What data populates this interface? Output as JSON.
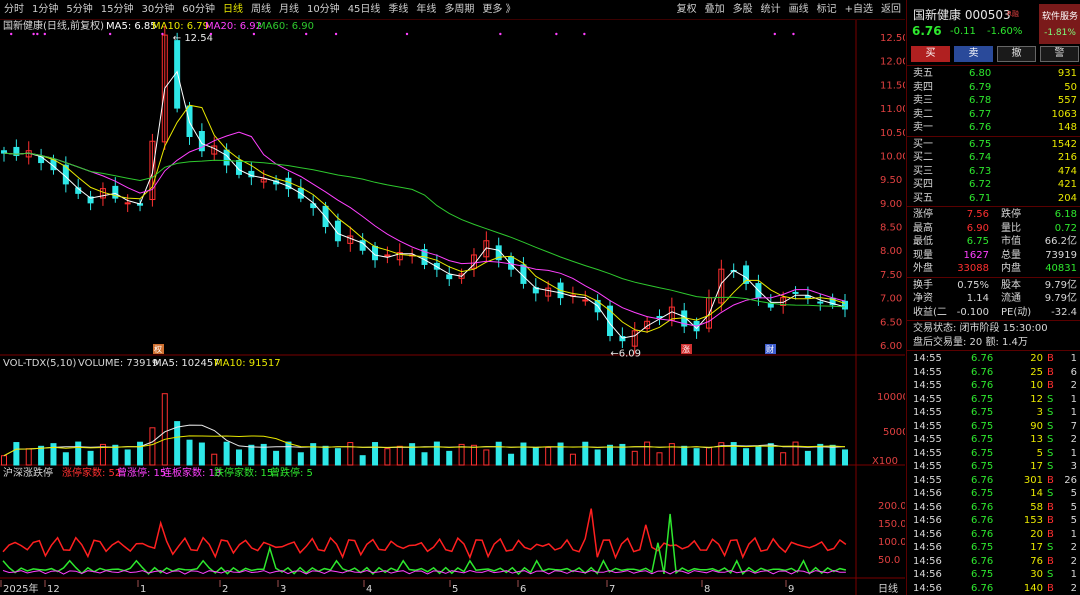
{
  "toolbar": {
    "periods": [
      "分时",
      "1分钟",
      "5分钟",
      "15分钟",
      "30分钟",
      "60分钟",
      "日线",
      "周线",
      "月线",
      "10分钟",
      "45日线",
      "季线",
      "年线",
      "多周期",
      "更多 》"
    ],
    "active_period": "日线",
    "right_items": [
      "复权",
      "叠加",
      "多股",
      "统计",
      "画线",
      "标记",
      "+自选",
      "返回"
    ]
  },
  "main_legend": {
    "title": "国新健康(日线,前复权)",
    "ma5": "MA5: 6.85",
    "ma10": "MA10: 6.79",
    "ma20": "MA20: 6.92",
    "ma60": "MA60: 6.90"
  },
  "price_axis": [
    "12.50",
    "12.00",
    "11.50",
    "11.00",
    "10.50",
    "10.00",
    "9.50",
    "9.00",
    "8.50",
    "8.00",
    "7.50",
    "7.00",
    "6.50",
    "6.00"
  ],
  "annotations": {
    "high": "12.54",
    "low": "6.09"
  },
  "vol_legend": {
    "label": "VOL-TDX(5,10)",
    "volume": "VOLUME: 73919",
    "ma5": "MA5: 102457",
    "ma10": "MA10: 91517"
  },
  "vol_axis": [
    "10000",
    "5000"
  ],
  "vol_unit": "X100",
  "breadth_legend": {
    "label": "沪深涨跌停",
    "up_count": "涨停家数: 52",
    "ever_up": "曾涨停: 15",
    "cont_up": "连板家数: 13",
    "down_count": "跌停家数: 15",
    "ever_down": "曾跌停: 5"
  },
  "breadth_axis": [
    "200.0",
    "150.0",
    "100.0",
    "50.0"
  ],
  "date_axis": [
    "2025年",
    "12",
    "1",
    "2",
    "3",
    "4",
    "5",
    "6",
    "7",
    "8",
    "9"
  ],
  "period_label": "日线",
  "markers": {
    "m1": "权",
    "m2": "涨",
    "m3": "财"
  },
  "colors": {
    "up": "#ff3030",
    "down": "#2ee8e8",
    "ma5": "#ffffff",
    "ma10": "#e8e800",
    "ma20": "#ff40ff",
    "ma60": "#2ec82e"
  },
  "chart_data": {
    "type": "candlestick",
    "ylim": [
      6.0,
      12.5
    ],
    "months": [
      "2025年12月",
      "1",
      "2",
      "3",
      "4",
      "5",
      "6",
      "7",
      "8",
      "9"
    ],
    "close_path": [
      10.05,
      10.0,
      10.1,
      9.85,
      9.7,
      9.4,
      9.2,
      9.0,
      9.3,
      9.1,
      9.0,
      8.95,
      10.3,
      12.54,
      11.0,
      10.4,
      10.1,
      10.2,
      9.8,
      9.6,
      9.55,
      9.5,
      9.4,
      9.3,
      9.1,
      8.9,
      8.5,
      8.2,
      8.3,
      8.0,
      7.8,
      7.9,
      7.95,
      7.9,
      7.7,
      7.6,
      7.4,
      7.5,
      7.9,
      8.2,
      7.8,
      7.6,
      7.3,
      7.1,
      7.2,
      7.0,
      7.05,
      6.95,
      6.7,
      6.2,
      6.09,
      6.3,
      6.5,
      6.6,
      6.8,
      6.4,
      6.3,
      7.0,
      7.6,
      7.55,
      7.3,
      7.0,
      6.8,
      7.0,
      7.1,
      7.0,
      6.9,
      6.85,
      6.76
    ]
  },
  "panel": {
    "name": "国新健康 000503",
    "badge": "R融",
    "soft_btn": "软件服务",
    "soft_pct": "-1.81%",
    "price": "6.76",
    "change": "-0.11",
    "pct": "-1.60%",
    "buttons": [
      "买",
      "卖",
      "撤",
      "警"
    ],
    "asks": [
      {
        "label": "卖五",
        "price": "6.80",
        "vol": "931"
      },
      {
        "label": "卖四",
        "price": "6.79",
        "vol": "50"
      },
      {
        "label": "卖三",
        "price": "6.78",
        "vol": "557"
      },
      {
        "label": "卖二",
        "price": "6.77",
        "vol": "1063"
      },
      {
        "label": "卖一",
        "price": "6.76",
        "vol": "148"
      }
    ],
    "bids": [
      {
        "label": "买一",
        "price": "6.75",
        "vol": "1542"
      },
      {
        "label": "买二",
        "price": "6.74",
        "vol": "216"
      },
      {
        "label": "买三",
        "price": "6.73",
        "vol": "474"
      },
      {
        "label": "买四",
        "price": "6.72",
        "vol": "421"
      },
      {
        "label": "买五",
        "price": "6.71",
        "vol": "204"
      }
    ],
    "stats": [
      {
        "l1": "涨停",
        "v1": "7.56",
        "l2": "跌停",
        "v2": "6.18"
      },
      {
        "l1": "最高",
        "v1": "6.90",
        "l2": "量比",
        "v2": "0.72"
      },
      {
        "l1": "最低",
        "v1": "6.75",
        "l2": "市值",
        "v2": "66.2亿"
      },
      {
        "l1": "现量",
        "v1": "1627",
        "l2": "总量",
        "v2": "73919"
      },
      {
        "l1": "外盘",
        "v1": "33088",
        "l2": "内盘",
        "v2": "40831"
      }
    ],
    "stats2": [
      {
        "l1": "换手",
        "v1": "0.75%",
        "l2": "股本",
        "v2": "9.79亿"
      },
      {
        "l1": "净资",
        "v1": "1.14",
        "l2": "流通",
        "v2": "9.79亿"
      },
      {
        "l1": "收益(二",
        "v1": "-0.100",
        "l2": "PE(动)",
        "v2": "-32.4"
      }
    ],
    "trade_status": "交易状态: 闭市阶段 15:30:00",
    "after_hours": "盘后交易量: 20  额: 1.4万",
    "ticks": [
      {
        "t": "14:55",
        "p": "6.76",
        "v": "20",
        "s": "B",
        "n": "1"
      },
      {
        "t": "14:55",
        "p": "6.76",
        "v": "25",
        "s": "B",
        "n": "6"
      },
      {
        "t": "14:55",
        "p": "6.76",
        "v": "10",
        "s": "B",
        "n": "2"
      },
      {
        "t": "14:55",
        "p": "6.75",
        "v": "12",
        "s": "S",
        "n": "1"
      },
      {
        "t": "14:55",
        "p": "6.75",
        "v": "3",
        "s": "S",
        "n": "1"
      },
      {
        "t": "14:55",
        "p": "6.75",
        "v": "90",
        "s": "S",
        "n": "7"
      },
      {
        "t": "14:55",
        "p": "6.75",
        "v": "13",
        "s": "S",
        "n": "2"
      },
      {
        "t": "14:55",
        "p": "6.75",
        "v": "5",
        "s": "S",
        "n": "1"
      },
      {
        "t": "14:55",
        "p": "6.75",
        "v": "17",
        "s": "S",
        "n": "3"
      },
      {
        "t": "14:55",
        "p": "6.76",
        "v": "301",
        "s": "B",
        "n": "26"
      },
      {
        "t": "14:56",
        "p": "6.75",
        "v": "14",
        "s": "S",
        "n": "5"
      },
      {
        "t": "14:56",
        "p": "6.76",
        "v": "58",
        "s": "B",
        "n": "5"
      },
      {
        "t": "14:56",
        "p": "6.76",
        "v": "153",
        "s": "B",
        "n": "5"
      },
      {
        "t": "14:56",
        "p": "6.76",
        "v": "20",
        "s": "B",
        "n": "1"
      },
      {
        "t": "14:56",
        "p": "6.75",
        "v": "17",
        "s": "S",
        "n": "2"
      },
      {
        "t": "14:56",
        "p": "6.76",
        "v": "76",
        "s": "B",
        "n": "2"
      },
      {
        "t": "14:56",
        "p": "6.75",
        "v": "30",
        "s": "S",
        "n": "1"
      },
      {
        "t": "14:56",
        "p": "6.76",
        "v": "140",
        "s": "B",
        "n": "2"
      }
    ]
  }
}
